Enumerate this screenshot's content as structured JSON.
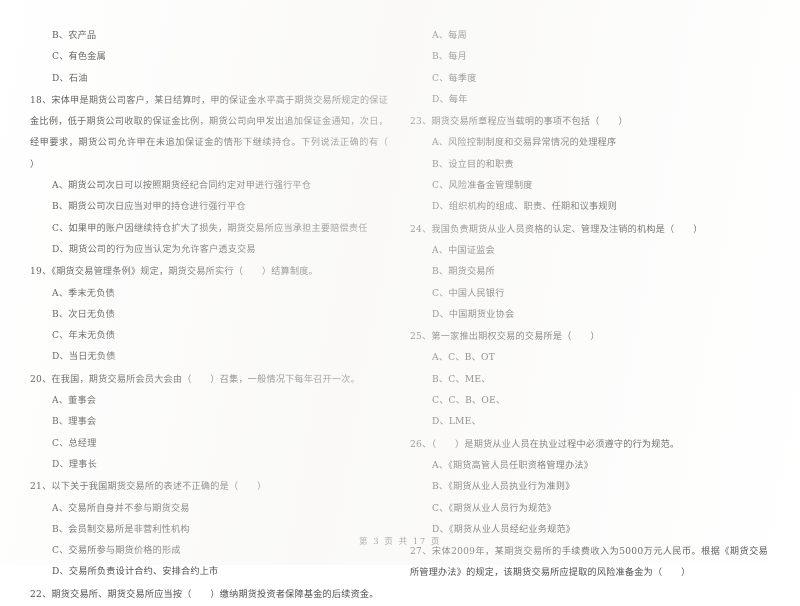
{
  "document": {
    "page_footer": "第 3 页  共 17 页"
  },
  "left_column": {
    "blocks": [
      {
        "id": "q17-tail-options",
        "stem": "",
        "options": [
          "B、农产品",
          "C、有色金属",
          "D、石油"
        ]
      },
      {
        "id": "q18",
        "stem": "18、宋体甲是期货公司客户，某日结算时，甲的保证金水平高于期货交易所规定的保证金比例，低于期货公司收取的保证金比例，期货公司向甲发出追加保证金通知，次日，经甲要求，期货公司允许甲在未追加保证金的情形下继续持仓。下列说法正确的有（      ）",
        "options": [
          "A、期货公司次日可以按照期货经纪合同约定对甲进行强行平仓",
          "B、期货公司次日应当对甲的持仓进行强行平仓",
          "C、如果甲的账户因继续持仓扩大了损失，期货交易所应当承担主要赔偿责任",
          "D、期货公司的行为应当认定为允许客户透支交易"
        ]
      },
      {
        "id": "q19",
        "stem": "19、《期货交易管理条例》规定，期货交易所实行（      ）结算制度。",
        "options": [
          "A、季末无负债",
          "B、次日无负债",
          "C、年末无负债",
          "D、当日无负债"
        ]
      },
      {
        "id": "q20",
        "stem": "20、在我国，期货交易所会员大会由（      ）召集，一般情况下每年召开一次。",
        "options": [
          "A、董事会",
          "B、理事会",
          "C、总经理",
          "D、理事长"
        ]
      },
      {
        "id": "q21",
        "stem": "21、以下关于我国期货交易所的表述不正确的是（      ）",
        "options": [
          "A、交易所自身并不参与期货交易",
          "B、会员制交易所是非营利性机构",
          "C、交易所参与期货价格的形成",
          "D、交易所负责设计合约、安排合约上市"
        ]
      },
      {
        "id": "q22",
        "stem": "22、期货交易所、期货交易所应当按（      ）缴纳期货投资者保障基金的后续资金。",
        "options": []
      }
    ]
  },
  "right_column": {
    "blocks": [
      {
        "id": "q22-options",
        "stem": "",
        "options": [
          "A、每周",
          "B、每月",
          "C、每季度",
          "D、每年"
        ]
      },
      {
        "id": "q23",
        "stem": "23、期货交易所章程应当载明的事项不包括（      ）",
        "options": [
          "A、风险控制制度和交易异常情况的处理程序",
          "B、设立目的和职责",
          "C、风险准备金管理制度",
          "D、组织机构的组成、职责、任期和议事规则"
        ]
      },
      {
        "id": "q24",
        "stem": "24、我国负责期货从业人员资格的认定、管理及注销的机构是（      ）",
        "options": [
          "A、中国证监会",
          "B、期货交易所",
          "C、中国人民银行",
          "D、中国期货业协会"
        ]
      },
      {
        "id": "q25",
        "stem": "25、第一家推出期权交易的交易所是（      ）",
        "options": [
          "A、C、B、OT",
          "B、C、ME、",
          "C、C、B、OE、",
          "D、LME、"
        ]
      },
      {
        "id": "q26",
        "stem": "26、（      ）是期货从业人员在执业过程中必须遵守的行为规范。",
        "options": [
          "A、《期货高管人员任职资格管理办法》",
          "B、《期货从业人员执业行为准则》",
          "C、《期货从业人员行为规范》",
          "D、《期货从业人员经纪业务规范》"
        ]
      },
      {
        "id": "q27",
        "stem": "27、宋体2009年，某期货交易所的手续费收入为5000万元人民币。根据《期货交易所管理办法》的规定，该期货交易所应提取的风险准备金为（      ）",
        "options": []
      }
    ]
  }
}
